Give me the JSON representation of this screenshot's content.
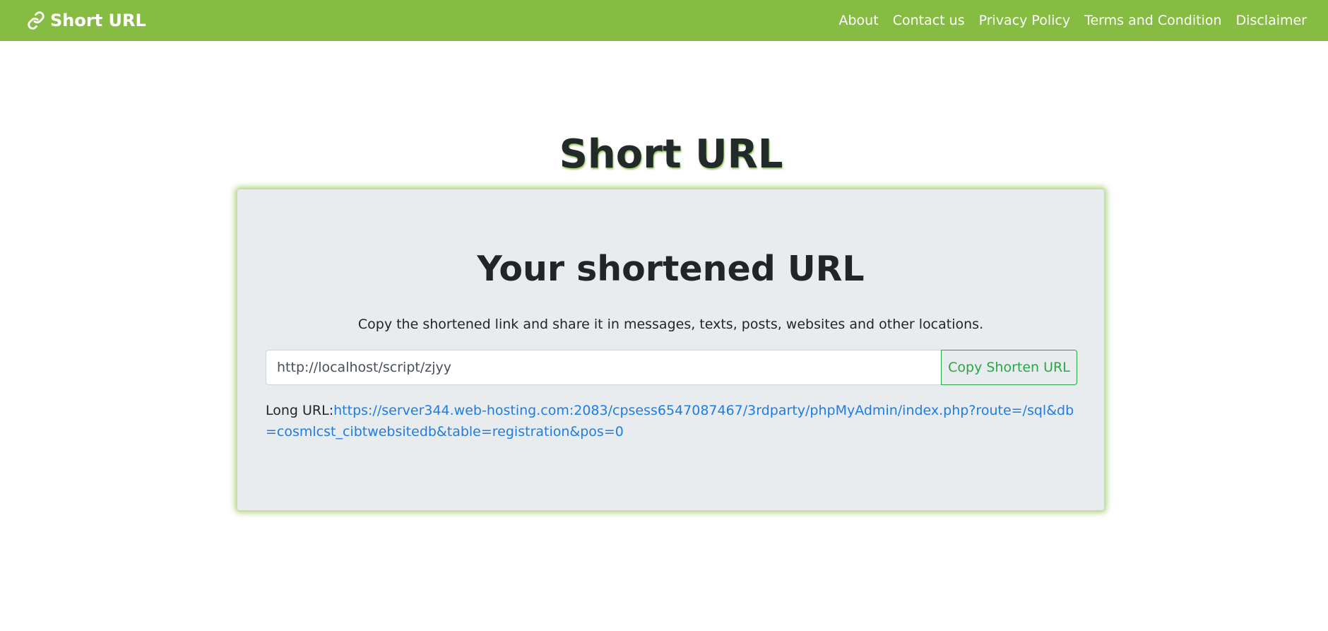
{
  "navbar": {
    "brand": "Short URL",
    "brand_icon": "link-icon",
    "links": [
      "About",
      "Contact us",
      "Privacy Policy",
      "Terms and Condition",
      "Disclaimer"
    ]
  },
  "page": {
    "title": "Short URL"
  },
  "result_card": {
    "heading": "Your shortened URL",
    "description": "Copy the shortened link and share it in messages, texts, posts, websites and other locations.",
    "short_url_value": "http://localhost/script/zjyy",
    "copy_button_label": "Copy Shorten URL",
    "long_url_label": "Long URL:",
    "long_url": "https://server344.web-hosting.com:2083/cpsess6547087467/3rdparty/phpMyAdmin/index.php?route=/sql&db=cosmlcst_cibtwebsitedb&table=registration&pos=0"
  },
  "colors": {
    "navbar_bg": "#86bc42",
    "card_bg": "#e9ecef",
    "button_accent": "#28a745",
    "link": "#1f7de0"
  }
}
